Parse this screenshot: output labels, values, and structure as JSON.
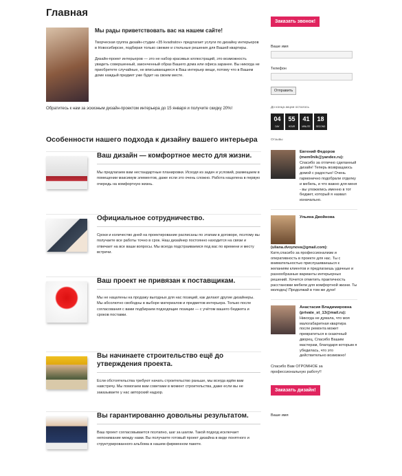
{
  "page": {
    "title": "Главная"
  },
  "intro": {
    "heading": "Мы рады приветствовать вас на нашем сайте!",
    "p1": "Творческая группа дизайн-студии «35 kvadratov» предлагает услуги по дизайну интерьеров в Новосибирске, подбирая только свежие и стильные решения для Вашей квартиры.",
    "p2": "Дизайн-проект интерьеров — это не набор красивых иллюстраций, это возможность увидеть совершенный, законченный образ Вашего дома или офиса заранее. Вы никогда не приобретете случайные, не вписывающиеся в Ваш интерьер вещи, потому что в Вашем доме каждый предмет уже будет на своем месте.",
    "cta": "Обратитесь к нам за эскизным дизайн-проектом интерьера до 15 января и получите скидку 20%!"
  },
  "section_title": "Особенности нашего подхода к дизайну вашего интерьера",
  "features": [
    {
      "title": "Ваш дизайн — комфортное место для жизни.",
      "text": "Мы предлагаем вам нестандартные планировки. Исходя из задач и условий, размещаем в помещении максимум элементов, даже если это очень сложно. Работа нацелена в первую очередь на комфортную жизнь."
    },
    {
      "title": "Официальное сотрудничество.",
      "text": "Сроки и количество дней на проектирование расписаны по этапам в договоре, поэтому вы получаете все работы точно в срок. Наш дизайнер постоянно находится на связи и отвечает на все ваши вопросы. Мы всегда подстраиваемся под вас по времени и месту встречи."
    },
    {
      "title": "Ваш проект не привязан к поставщикам.",
      "text": "Мы не нацелены на продажу выгодных для нас позиций, как делают другие дизайнеры. Мы абсолютно свободны в выборе материалов и предметов интерьера. Только после согласования с вами подбираем подходящие позиции — с учётом вашего бюджета и сроков поставки."
    },
    {
      "title": "Вы начинаете строительство ещё до утверждения проекта.",
      "text": "Если обстоятельства требуют начать строительство раньше, мы всегда идём вам навстречу. Мы помогаем вам советами в момент строительства, даже если вы не заказываете у нас авторский надзор."
    },
    {
      "title": "Вы гарантированно довольны результатом.",
      "text": "Ваш проект согласовывается поэтапно, шаг за шагом. Такой подход исключает непонимание между нами. Вы получаете готовый проект дизайна в виде понятного и структурированного альбома в нашем фирменном пакете."
    }
  ],
  "sidebar": {
    "call_button": "Заказать звонок!",
    "name_label": "Ваше имя",
    "phone_label": "Телефон",
    "send_button": "Отправить",
    "timer_caption": "До конца акции осталось",
    "timer": [
      {
        "value": "04",
        "unit": "DAY"
      },
      {
        "value": "55",
        "unit": "HOUR"
      },
      {
        "value": "41",
        "unit": "MINUTE"
      },
      {
        "value": "18",
        "unit": "SECOND"
      }
    ],
    "reviews_label": "Отзывы",
    "reviews": [
      {
        "name": "Евгений Федоров (mem0nik@yandex.ru):",
        "text": "Спасибо за отлично сделанный дизайн! Теперь возвращаюсь домой с радостью! Очень гармонично подобрали отделку и мебель, и что важно для меня - вы уложились именно в тот бюджет, который я назвал изначально."
      },
      {
        "name": "Ульяна Двойнова",
        "email": "(uliana.dvoynova@gmail.com):",
        "text": "Катя,спасибо за профессионализм и оперативность в проекте для нас. Ты с внимательностью прислушиваешься к желаниям клиентов и предлагаешь удачные и разнообразные варианты интерьерных решений. Хочется отметить практичность расстановки мебели для комфортной жизни. Ты молодец! Продолжай в том же духе!"
      },
      {
        "name": "Анастасия Владимировна (private_st_13@mail.ru):",
        "text": "Никогда не думала, что моя малогабаритная квартира после ремонта может превратиться в сказочный дворец. Спасибо Вашим мастерам, благодаря которым я убедилась, что это действительно возможно!",
        "text2": "Спасибо Вам ОГРОМНОЕ за профессиональную работу!!"
      }
    ],
    "design_button": "Заказать дизайн!",
    "name_label_2": "Ваше имя"
  }
}
